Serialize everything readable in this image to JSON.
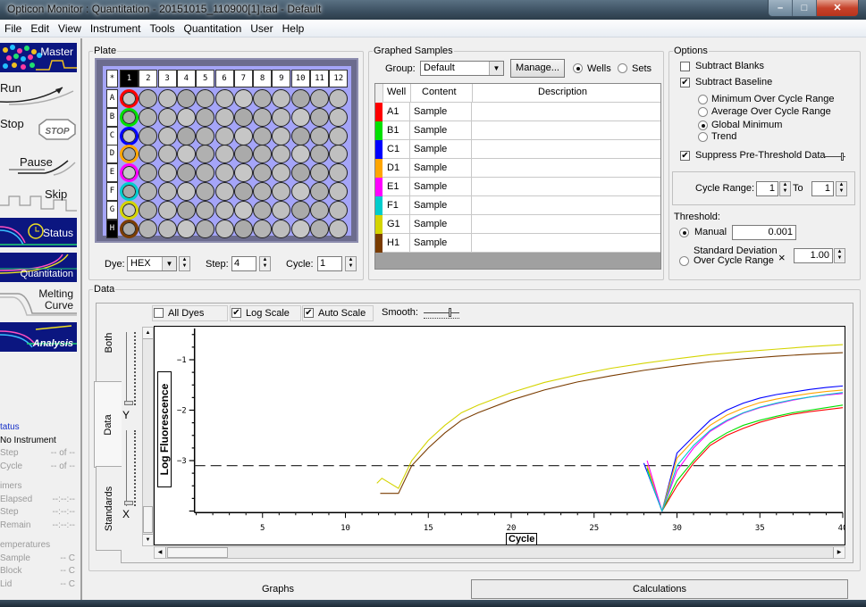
{
  "window": {
    "title": "Opticon Monitor : Quantitation - 20151015_110900[1].tad - Default",
    "controls": [
      "minimize",
      "maximize",
      "close"
    ]
  },
  "menu": [
    "File",
    "Edit",
    "View",
    "Instrument",
    "Tools",
    "Quantitation",
    "User",
    "Help"
  ],
  "sidebar": {
    "buttons": [
      {
        "label": "Master",
        "style": "dark"
      },
      {
        "label": "Run",
        "style": "light"
      },
      {
        "label": "Stop",
        "style": "light",
        "badge": "STOP"
      },
      {
        "label": "Pause",
        "style": "light"
      },
      {
        "label": "Skip",
        "style": "light"
      },
      {
        "label": "Status",
        "style": "dark"
      },
      {
        "label": "Quantitation",
        "style": "dark"
      },
      {
        "label": "Melting Curve",
        "style": "light"
      },
      {
        "label": "Analysis",
        "style": "dark"
      }
    ],
    "status": {
      "title": "tatus",
      "instrument": "No Instrument",
      "rows": [
        {
          "label": "Step",
          "value": "-- of --"
        },
        {
          "label": "Cycle",
          "value": "-- of --"
        }
      ],
      "timers_title": "imers",
      "timers": [
        {
          "label": "Elapsed",
          "value": "--:--:--"
        },
        {
          "label": "Step",
          "value": "--:--:--"
        },
        {
          "label": "Remain",
          "value": "--:--:--"
        }
      ],
      "temps_title": "emperatures",
      "temps": [
        {
          "label": "Sample",
          "value": "-- C"
        },
        {
          "label": "Block",
          "value": "-- C"
        },
        {
          "label": "Lid",
          "value": "-- C"
        }
      ]
    }
  },
  "plate": {
    "title": "Plate",
    "corner": "*",
    "columns": [
      "1",
      "2",
      "3",
      "4",
      "5",
      "6",
      "7",
      "8",
      "9",
      "10",
      "11",
      "12"
    ],
    "rows": [
      "A",
      "B",
      "C",
      "D",
      "E",
      "F",
      "G",
      "H"
    ],
    "selected_column": "1",
    "selected_row": "H",
    "dye_label": "Dye:",
    "dye_value": "HEX",
    "step_label": "Step:",
    "step_value": "4",
    "cycle_label": "Cycle:",
    "cycle_value": "1"
  },
  "graphed_samples": {
    "title": "Graphed Samples",
    "group_label": "Group:",
    "group_value": "Default",
    "manage_label": "Manage...",
    "wells_label": "Wells",
    "sets_label": "Sets",
    "mode": "Wells",
    "headers": [
      "Well",
      "Content",
      "Description"
    ],
    "rows": [
      {
        "well": "A1",
        "content": "Sample",
        "description": "",
        "color": "#ff0000"
      },
      {
        "well": "B1",
        "content": "Sample",
        "description": "",
        "color": "#00e000"
      },
      {
        "well": "C1",
        "content": "Sample",
        "description": "",
        "color": "#0000ff"
      },
      {
        "well": "D1",
        "content": "Sample",
        "description": "",
        "color": "#ffa500"
      },
      {
        "well": "E1",
        "content": "Sample",
        "description": "",
        "color": "#ff00ff"
      },
      {
        "well": "F1",
        "content": "Sample",
        "description": "",
        "color": "#00cccc"
      },
      {
        "well": "G1",
        "content": "Sample",
        "description": "",
        "color": "#d4d400"
      },
      {
        "well": "H1",
        "content": "Sample",
        "description": "",
        "color": "#7a3c00"
      }
    ]
  },
  "options": {
    "title": "Options",
    "subtract_blanks": {
      "label": "Subtract Blanks",
      "checked": false
    },
    "subtract_baseline": {
      "label": "Subtract Baseline",
      "checked": true
    },
    "baseline_methods": [
      {
        "label": "Minimum Over Cycle Range",
        "selected": false
      },
      {
        "label": "Average Over Cycle Range",
        "selected": false
      },
      {
        "label": "Global Minimum",
        "selected": true
      },
      {
        "label": "Trend",
        "selected": false
      }
    ],
    "suppress": {
      "label": "Suppress Pre-Threshold Data",
      "checked": true
    },
    "cycle_range_label": "Cycle Range:",
    "cycle_from": "1",
    "to_label": "To",
    "cycle_to": "1",
    "threshold_label": "Threshold:",
    "manual_label": "Manual",
    "manual_value": "0.001",
    "threshold_mode": "Manual",
    "stddev_label_1": "Standard Deviation",
    "stddev_label_2": "Over Cycle Range",
    "times": "×",
    "stddev_value": "1.00"
  },
  "data_panel": {
    "title": "Data",
    "all_dyes": {
      "label": "All Dyes",
      "checked": false
    },
    "log_scale": {
      "label": "Log Scale",
      "checked": true
    },
    "auto_scale": {
      "label": "Auto Scale",
      "checked": true
    },
    "smooth_label": "Smooth:",
    "side_tabs": [
      "Both",
      "Data",
      "Standards"
    ],
    "active_side_tab": "Data",
    "y_slider_label": "Y",
    "x_slider_label": "X"
  },
  "bottom_tabs": [
    "Graphs",
    "Calculations"
  ],
  "active_bottom_tab": "Graphs",
  "chart_data": {
    "type": "line",
    "title": "",
    "xlabel": "Cycle",
    "ylabel": "Log Fluorescence",
    "xlim": [
      0.9,
      40
    ],
    "ylim": [
      -4.03,
      -0.38
    ],
    "xticks": [
      5,
      10,
      15,
      20,
      25,
      30,
      35,
      40
    ],
    "yticks": [
      -1,
      -2,
      -3
    ],
    "threshold": -3.1,
    "grid": false,
    "series": [
      {
        "name": "A1",
        "color": "#ff0000",
        "x": [
          28.2,
          29.1,
          30,
          31,
          32,
          33,
          34,
          35,
          36,
          37,
          38,
          39,
          40
        ],
        "y": [
          -3.15,
          -4.0,
          -3.5,
          -3.05,
          -2.7,
          -2.5,
          -2.36,
          -2.24,
          -2.15,
          -2.08,
          -2.03,
          -1.99,
          -1.95
        ]
      },
      {
        "name": "B1",
        "color": "#00e000",
        "x": [
          28.2,
          29.1,
          30,
          31,
          32,
          33,
          34,
          35,
          36,
          37,
          38,
          39,
          40
        ],
        "y": [
          -3.15,
          -4.0,
          -3.4,
          -3.0,
          -2.65,
          -2.45,
          -2.3,
          -2.2,
          -2.12,
          -2.05,
          -2.0,
          -1.95,
          -1.9
        ]
      },
      {
        "name": "C1",
        "color": "#0000ff",
        "x": [
          28.0,
          29.1,
          30,
          31,
          32,
          33,
          34,
          35,
          36,
          37,
          38,
          39,
          40
        ],
        "y": [
          -3.05,
          -4.0,
          -2.85,
          -2.52,
          -2.2,
          -2.0,
          -1.86,
          -1.76,
          -1.69,
          -1.64,
          -1.59,
          -1.55,
          -1.52
        ]
      },
      {
        "name": "D1",
        "color": "#ffa500",
        "x": [
          28.2,
          29.1,
          30,
          31,
          32,
          33,
          34,
          35,
          36,
          37,
          38,
          39,
          40
        ],
        "y": [
          -3.1,
          -4.0,
          -2.95,
          -2.6,
          -2.3,
          -2.1,
          -1.96,
          -1.85,
          -1.78,
          -1.72,
          -1.67,
          -1.63,
          -1.6
        ]
      },
      {
        "name": "E1",
        "color": "#ff00ff",
        "x": [
          28.2,
          29.1,
          30,
          31,
          32,
          33,
          34,
          35,
          36,
          37,
          38,
          39,
          40
        ],
        "y": [
          -3.0,
          -4.0,
          -3.2,
          -2.75,
          -2.42,
          -2.22,
          -2.06,
          -1.95,
          -1.87,
          -1.8,
          -1.74,
          -1.7,
          -1.67
        ]
      },
      {
        "name": "F1",
        "color": "#00cccc",
        "x": [
          28.2,
          29.1,
          30,
          31,
          32,
          33,
          34,
          35,
          36,
          37,
          38,
          39,
          40
        ],
        "y": [
          -3.2,
          -4.0,
          -3.1,
          -2.7,
          -2.4,
          -2.2,
          -2.05,
          -1.94,
          -1.86,
          -1.79,
          -1.74,
          -1.69,
          -1.65
        ]
      },
      {
        "name": "G1",
        "color": "#d4d400",
        "x": [
          11.9,
          12.2,
          13.2,
          14.0,
          15.0,
          16.0,
          17.0,
          18.0,
          20,
          22,
          24,
          26,
          28,
          30,
          32,
          34,
          36,
          38,
          40
        ],
        "y": [
          -3.45,
          -3.35,
          -3.55,
          -3.0,
          -2.6,
          -2.3,
          -2.05,
          -1.9,
          -1.65,
          -1.45,
          -1.3,
          -1.17,
          -1.07,
          -0.98,
          -0.9,
          -0.84,
          -0.79,
          -0.74,
          -0.7
        ]
      },
      {
        "name": "H1",
        "color": "#7a3c00",
        "x": [
          12.1,
          13.2,
          14.0,
          15.0,
          16.0,
          17.0,
          18.0,
          20,
          22,
          24,
          26,
          28,
          30,
          32,
          34,
          36,
          38,
          40
        ],
        "y": [
          -3.65,
          -3.65,
          -3.1,
          -2.75,
          -2.45,
          -2.2,
          -2.05,
          -1.8,
          -1.6,
          -1.44,
          -1.32,
          -1.21,
          -1.12,
          -1.04,
          -0.98,
          -0.93,
          -0.89,
          -0.86
        ]
      }
    ]
  }
}
